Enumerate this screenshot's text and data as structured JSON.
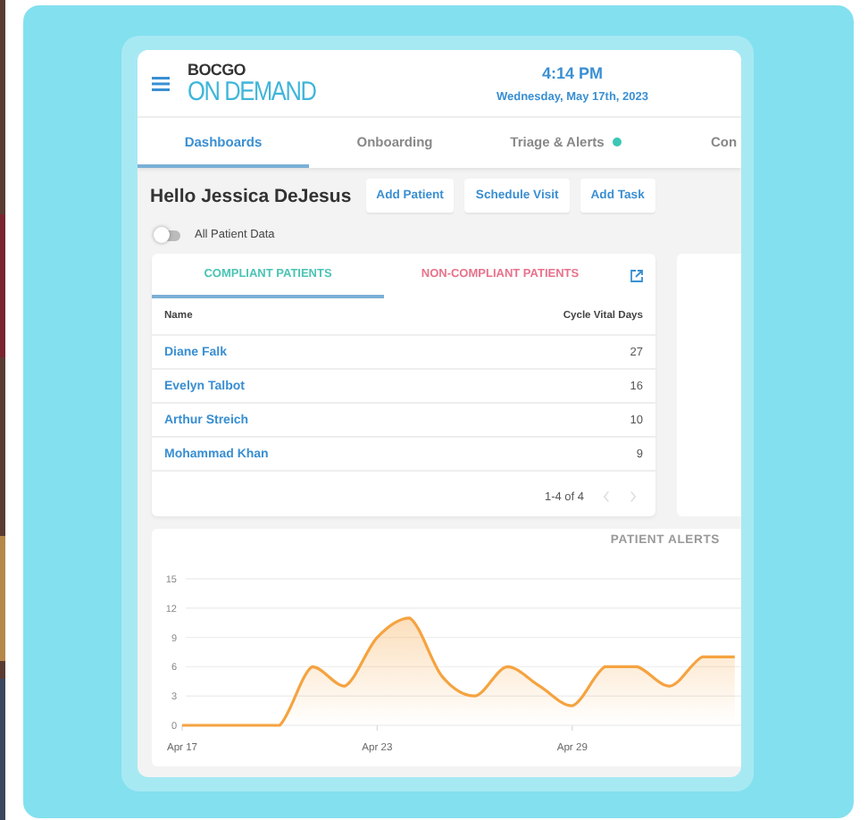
{
  "header": {
    "brand_top": "BOCGO",
    "brand_main": "ON DEMAND",
    "time": "4:14 PM",
    "date": "Wednesday, May 17th, 2023"
  },
  "tabs": [
    {
      "label": "Dashboards",
      "selected": true,
      "alert_dot": false
    },
    {
      "label": "Onboarding",
      "selected": false,
      "alert_dot": false
    },
    {
      "label": "Triage & Alerts",
      "selected": false,
      "alert_dot": true
    },
    {
      "label": "Con",
      "selected": false,
      "alert_dot": false
    }
  ],
  "greeting": "Hello Jessica DeJesus",
  "actions": [
    "Add Patient",
    "Schedule Visit",
    "Add Task"
  ],
  "toggle": {
    "label": "All Patient Data",
    "on": false
  },
  "patients": {
    "tabs": [
      {
        "label": "COMPLIANT PATIENTS",
        "selected": true,
        "color": "#4cc4b4"
      },
      {
        "label": "NON-COMPLIANT PATIENTS",
        "selected": false,
        "color": "#e8738c"
      }
    ],
    "columns": [
      "Name",
      "Cycle Vital Days"
    ],
    "rows": [
      {
        "name": "Diane Falk",
        "days": "27"
      },
      {
        "name": "Evelyn Talbot",
        "days": "16"
      },
      {
        "name": "Arthur Streich",
        "days": "10"
      },
      {
        "name": "Mohammad Khan",
        "days": "9"
      }
    ],
    "pagination": {
      "range": "1-4 of 4",
      "prev_disabled": true,
      "next_disabled": true
    }
  },
  "alerts_chart": {
    "chart_data": {
      "type": "area",
      "title": "PATIENT ALERTS",
      "categories": [
        "Apr 17",
        null,
        null,
        null,
        null,
        null,
        "Apr 23",
        null,
        null,
        null,
        null,
        null,
        "Apr 29",
        null,
        null,
        null,
        null,
        null
      ],
      "series": [
        {
          "color": "#f5a340",
          "values": [
            0,
            0,
            0,
            0,
            6,
            4,
            9,
            11,
            5,
            3,
            6,
            4,
            2,
            6,
            6,
            4,
            7,
            7
          ]
        }
      ],
      "ylim": [
        0,
        15
      ],
      "grid": true,
      "yticks": [
        0,
        3,
        6,
        9,
        12,
        15
      ]
    }
  }
}
